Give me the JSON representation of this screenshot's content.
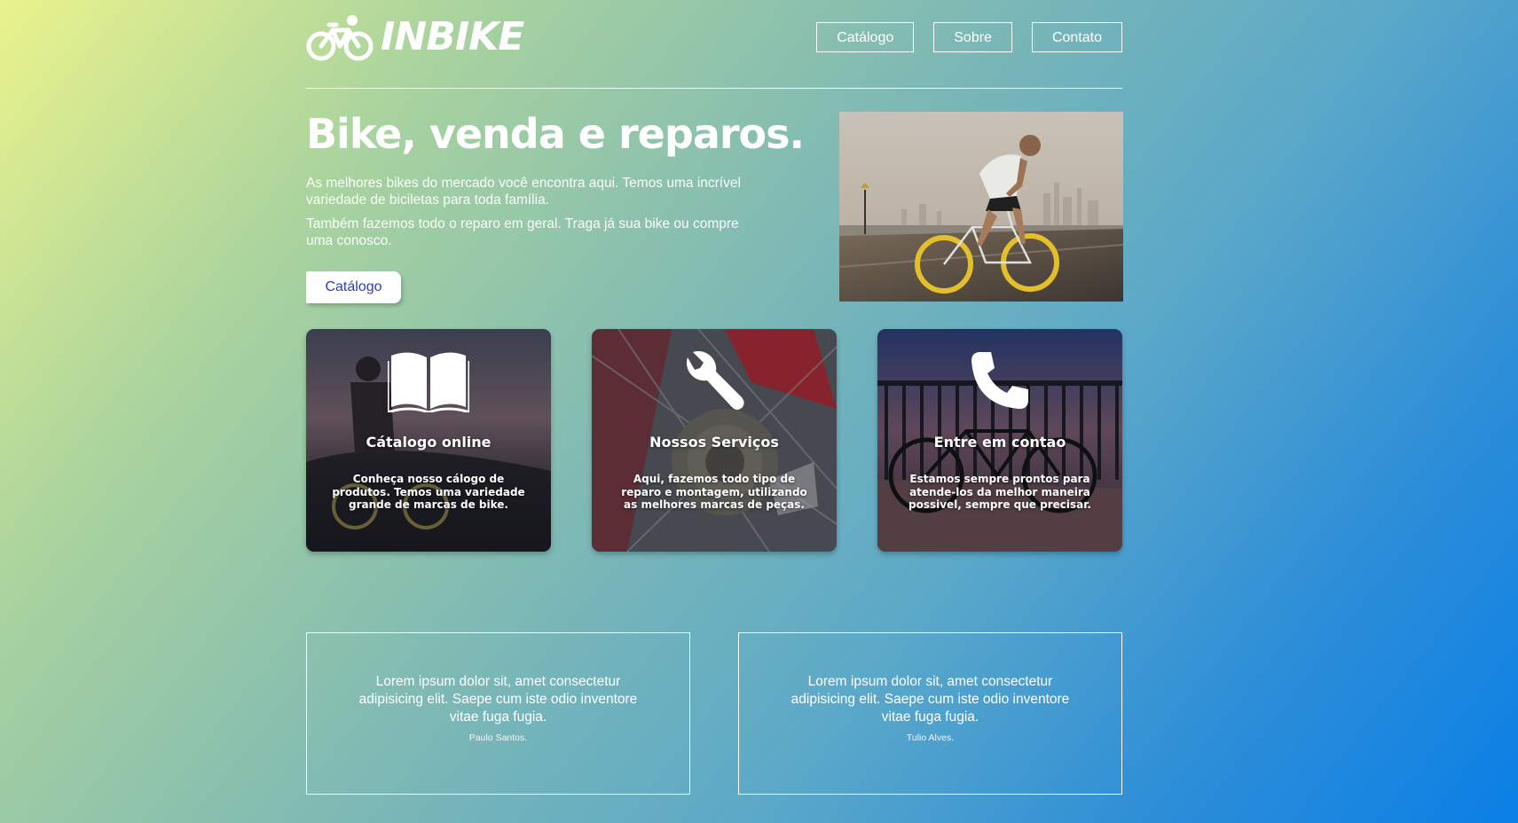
{
  "brand": {
    "name": "INBIKE",
    "logo_icon": "bicycle-icon"
  },
  "nav": {
    "items": [
      "Catálogo",
      "Sobre",
      "Contato"
    ]
  },
  "hero": {
    "title": "Bike, venda e reparos.",
    "paragraph1": "As melhores bikes do mercado você encontra aqui. Temos uma incrível variedade de biciletas para toda família.",
    "paragraph2": "Também fazemos todo o reparo em geral. Traga já sua bike ou compre uma conosco.",
    "button": "Catálogo"
  },
  "cards": [
    {
      "icon": "open-book-icon",
      "title": "Cátalogo online",
      "text": "Conheça nosso cálogo de produtos. Temos uma variedade grande de marcas de bike."
    },
    {
      "icon": "wrench-icon",
      "title": "Nossos Serviços",
      "text": "Aqui, fazemos todo tipo de reparo e montagem, utilizando as melhores marcas de peças."
    },
    {
      "icon": "phone-icon",
      "title": "Entre em contao",
      "text": "Estamos sempre prontos para atende-los da melhor maneira possivel, sempre que precisar."
    }
  ],
  "testimonials": [
    {
      "quote": "Lorem ipsum dolor sit, amet consectetur adipisicing elit. Saepe cum iste odio inventore vitae fuga fugia.",
      "author": "Paulo Santos."
    },
    {
      "quote": "Lorem ipsum dolor sit, amet consectetur adipisicing elit. Saepe cum iste odio inventore vitae fuga fugia.",
      "author": "Tulio Alves."
    }
  ],
  "colors": {
    "button_text": "#2a3cc7",
    "gradient_start": "#eaf38c",
    "gradient_end": "#0a7fe6"
  }
}
